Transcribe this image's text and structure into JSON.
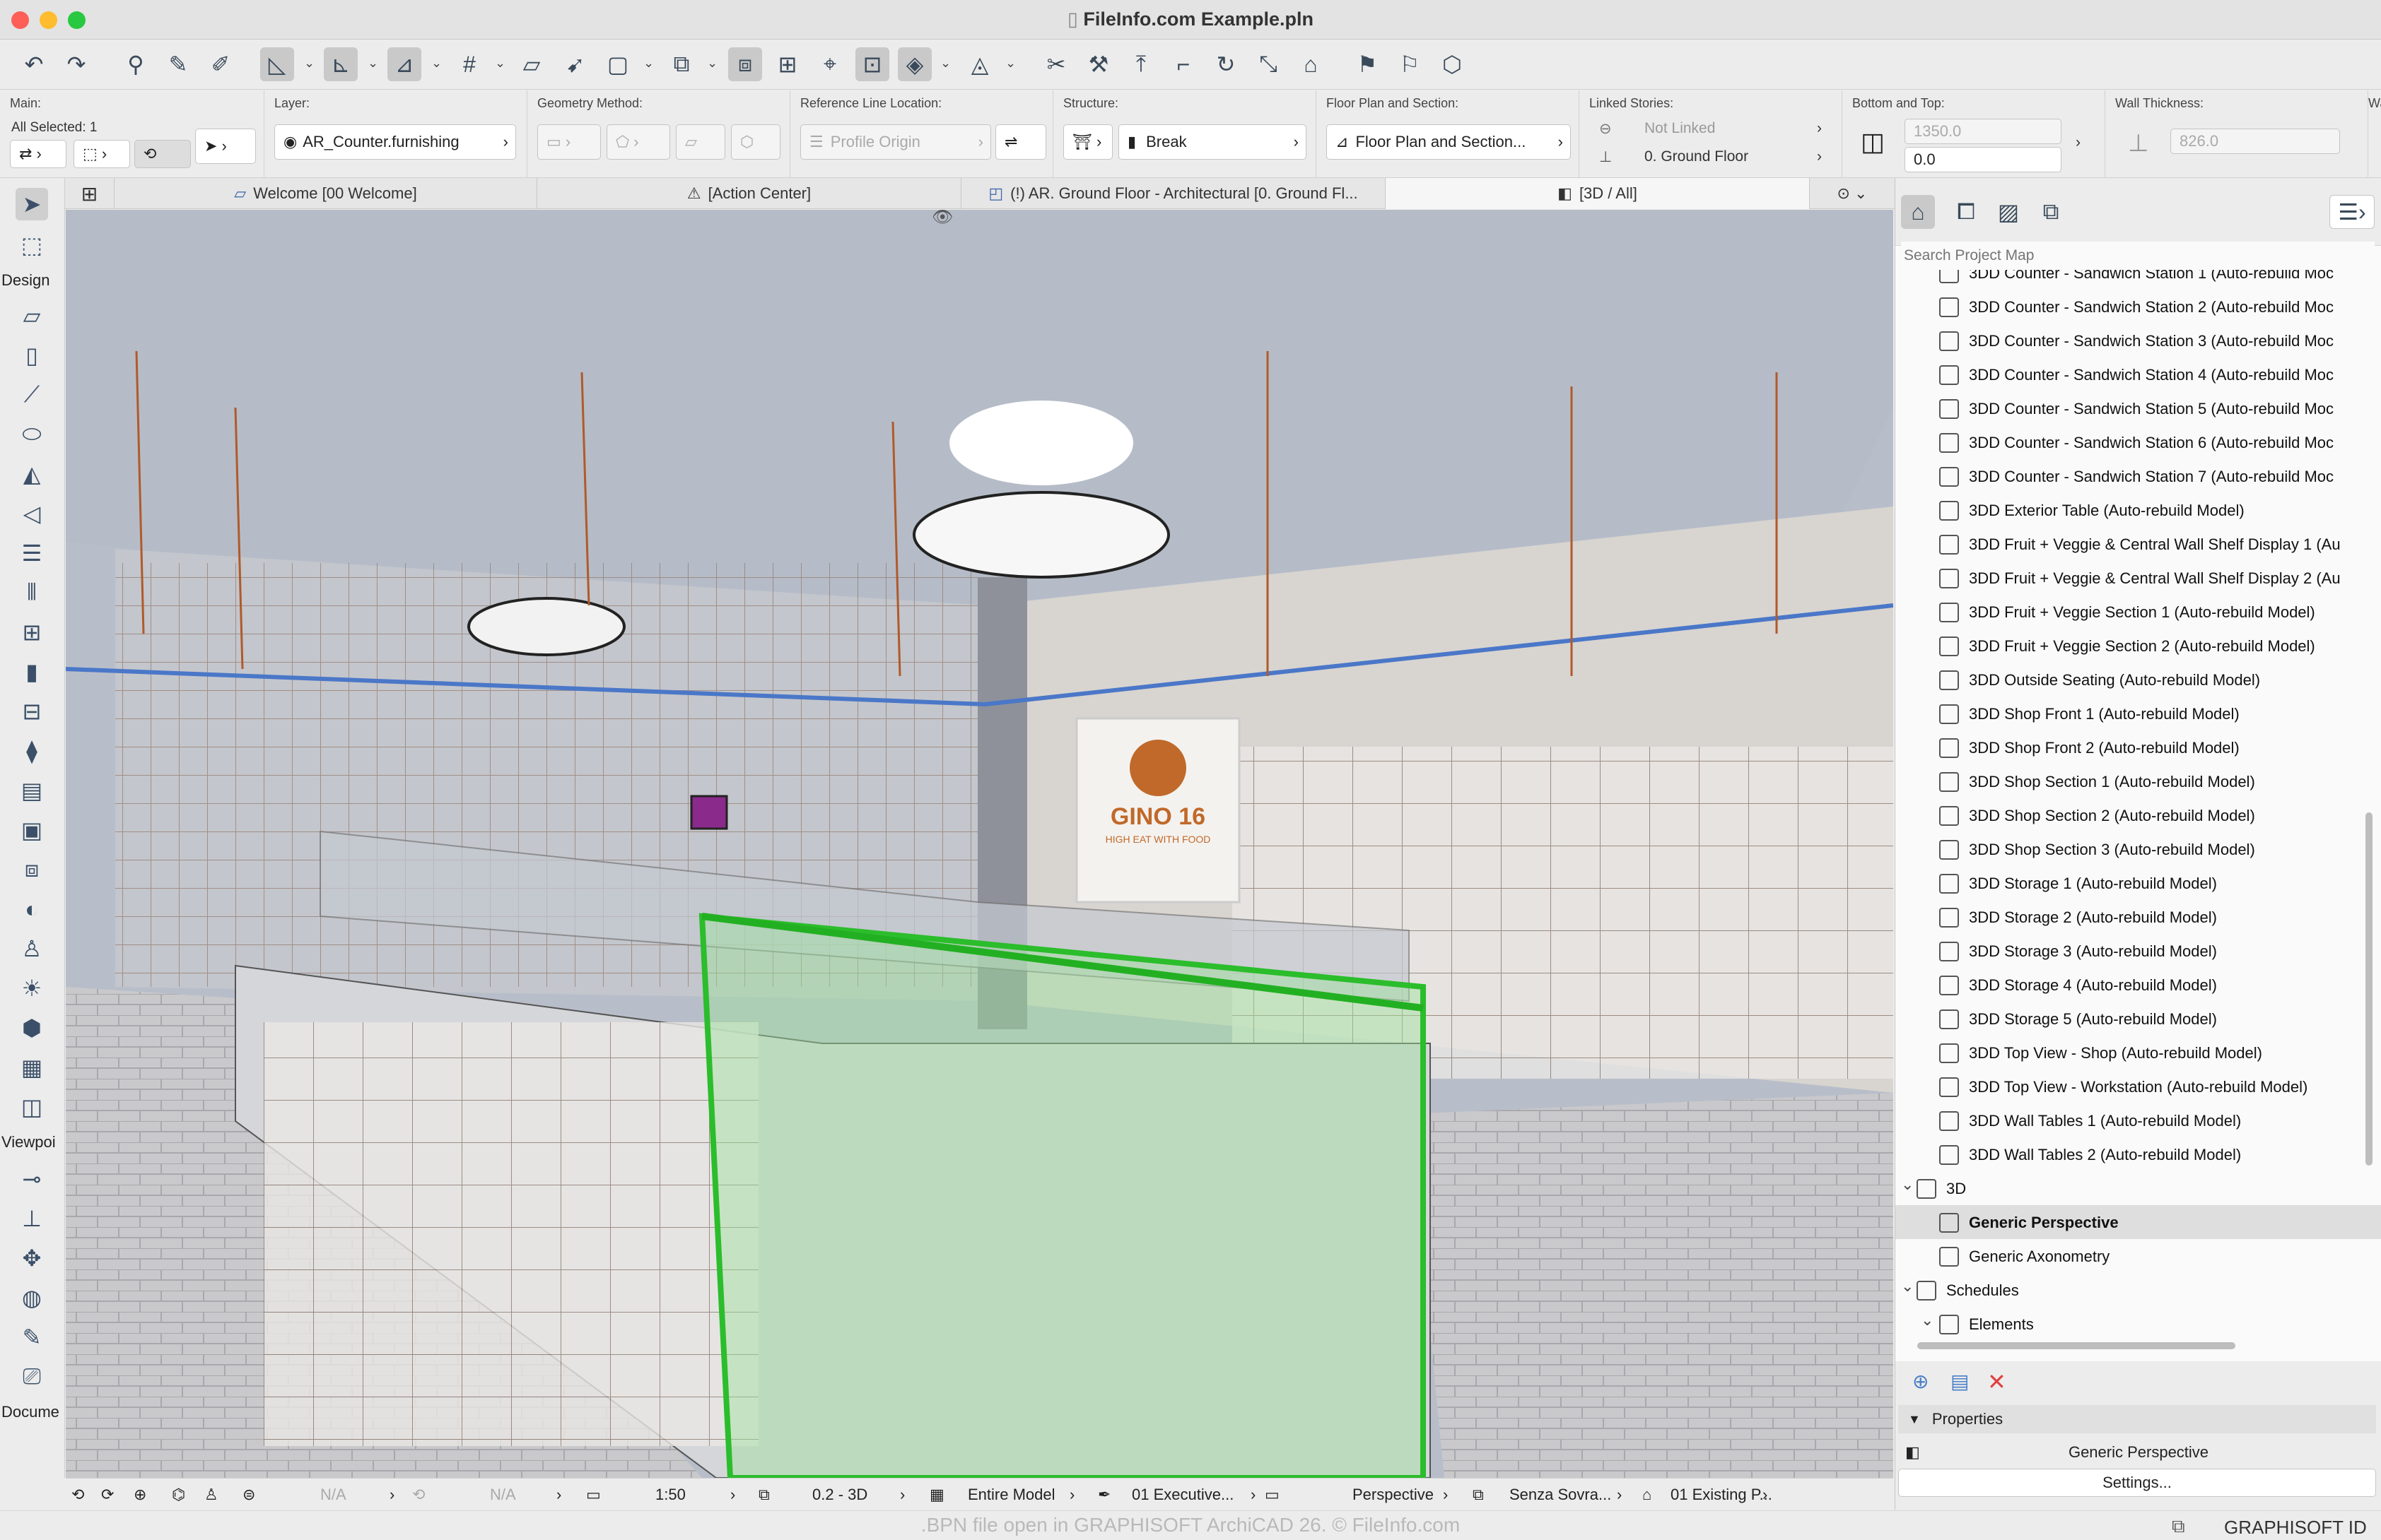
{
  "window": {
    "title": "FileInfo.com Example.pln",
    "traffic_colors": [
      "#fe5f57",
      "#febc2e",
      "#28c840"
    ]
  },
  "infobox": {
    "main_label": "Main:",
    "all_selected": "All Selected: 1",
    "layer_label": "Layer:",
    "layer_value": "AR_Counter.furnishing",
    "geometry_label": "Geometry Method:",
    "refline_label": "Reference Line Location:",
    "refline_value": "Profile Origin",
    "structure_label": "Structure:",
    "structure_value": "Break",
    "floorplan_label": "Floor Plan and Section:",
    "floorplan_value": "Floor Plan and Section...",
    "linked_label": "Linked Stories:",
    "linked_top": "Not Linked",
    "linked_bottom": "0. Ground Floor",
    "bottomtop_label": "Bottom and Top:",
    "top_value": "1350.0",
    "bottom_value": "0.0",
    "thickness_label": "Wall Thickness:",
    "thickness_value": "826.0",
    "trailing_label": "Wa"
  },
  "tabs": [
    {
      "label": "Welcome [00 Welcome]",
      "icon": "layout-icon"
    },
    {
      "label": "[Action Center]",
      "icon": "action-center-icon"
    },
    {
      "label": "(!) AR. Ground Floor - Architectural [0. Ground Fl...",
      "icon": "floor-plan-icon"
    },
    {
      "label": "[3D / All]",
      "icon": "cube-icon"
    }
  ],
  "toolbox": {
    "design_label": "Design",
    "viewpoint_label": "Viewpoi",
    "document_label": "Docume"
  },
  "navigator": {
    "search_placeholder": "Search Project Map",
    "items": [
      {
        "label": "3DD Counter - Sandwich Station 1 (Auto-rebuild Moc",
        "level": 2
      },
      {
        "label": "3DD Counter - Sandwich Station 2 (Auto-rebuild Moc",
        "level": 2
      },
      {
        "label": "3DD Counter - Sandwich Station 3 (Auto-rebuild Moc",
        "level": 2
      },
      {
        "label": "3DD Counter - Sandwich Station 4 (Auto-rebuild Moc",
        "level": 2
      },
      {
        "label": "3DD Counter - Sandwich Station 5 (Auto-rebuild Moc",
        "level": 2
      },
      {
        "label": "3DD Counter - Sandwich Station 6 (Auto-rebuild Moc",
        "level": 2
      },
      {
        "label": "3DD Counter - Sandwich Station 7 (Auto-rebuild Moc",
        "level": 2
      },
      {
        "label": "3DD Exterior Table (Auto-rebuild Model)",
        "level": 2
      },
      {
        "label": "3DD Fruit + Veggie & Central Wall Shelf Display 1 (Au",
        "level": 2
      },
      {
        "label": "3DD Fruit + Veggie & Central Wall Shelf Display 2 (Au",
        "level": 2
      },
      {
        "label": "3DD Fruit + Veggie Section 1 (Auto-rebuild Model)",
        "level": 2
      },
      {
        "label": "3DD Fruit + Veggie Section 2 (Auto-rebuild Model)",
        "level": 2
      },
      {
        "label": "3DD Outside Seating (Auto-rebuild Model)",
        "level": 2
      },
      {
        "label": "3DD Shop Front 1 (Auto-rebuild Model)",
        "level": 2
      },
      {
        "label": "3DD Shop Front 2 (Auto-rebuild Model)",
        "level": 2
      },
      {
        "label": "3DD Shop Section 1 (Auto-rebuild Model)",
        "level": 2
      },
      {
        "label": "3DD Shop Section 2 (Auto-rebuild Model)",
        "level": 2
      },
      {
        "label": "3DD Shop Section 3 (Auto-rebuild Model)",
        "level": 2
      },
      {
        "label": "3DD Storage 1 (Auto-rebuild Model)",
        "level": 2
      },
      {
        "label": "3DD Storage 2 (Auto-rebuild Model)",
        "level": 2
      },
      {
        "label": "3DD Storage 3 (Auto-rebuild Model)",
        "level": 2
      },
      {
        "label": "3DD Storage 4 (Auto-rebuild Model)",
        "level": 2
      },
      {
        "label": "3DD Storage 5 (Auto-rebuild Model)",
        "level": 2
      },
      {
        "label": "3DD Top View - Shop (Auto-rebuild Model)",
        "level": 2
      },
      {
        "label": "3DD Top View - Workstation (Auto-rebuild Model)",
        "level": 2
      },
      {
        "label": "3DD Wall Tables 1 (Auto-rebuild Model)",
        "level": 2
      },
      {
        "label": "3DD Wall Tables 2 (Auto-rebuild Model)",
        "level": 2
      },
      {
        "label": "3D",
        "level": 1
      },
      {
        "label": "Generic Perspective",
        "level": 2,
        "selected": true
      },
      {
        "label": "Generic Axonometry",
        "level": 2
      },
      {
        "label": "Schedules",
        "level": 1
      },
      {
        "label": "Elements",
        "level": 2
      }
    ]
  },
  "properties": {
    "header": "Properties",
    "view_name": "Generic Perspective",
    "settings_button": "Settings..."
  },
  "statusbar": {
    "na1": "N/A",
    "na2": "N/A",
    "scale": "1:50",
    "layer_combo": "0.2 - 3D",
    "model_view": "Entire Model",
    "pen_set": "01 Executive...",
    "projection": "Perspective",
    "override": "Senza Sovra...",
    "renovation": "01 Existing P..."
  },
  "footer": {
    "brand": "GRAPHISOFT ID",
    "caption": ".BPN file open in GRAPHISOFT ArchiCAD 26. © FileInfo.com"
  },
  "viewport": {
    "sign_text": "GINO 16",
    "sign_sub": "HIGH EAT WITH FOOD"
  }
}
